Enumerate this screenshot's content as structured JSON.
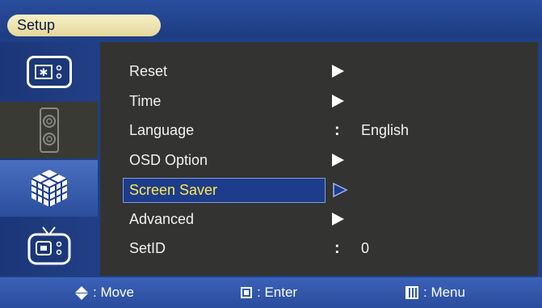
{
  "title": "Setup",
  "sidebar": {
    "items": [
      {
        "icon": "picture-icon"
      },
      {
        "icon": "audio-speaker-icon"
      },
      {
        "icon": "setup-cube-icon"
      },
      {
        "icon": "tv-channel-icon"
      }
    ]
  },
  "menu": {
    "items": [
      {
        "label": "Reset",
        "type": "submenu"
      },
      {
        "label": "Time",
        "type": "submenu"
      },
      {
        "label": "Language",
        "type": "value",
        "value": "English"
      },
      {
        "label": "OSD Option",
        "type": "submenu"
      },
      {
        "label": "Screen Saver",
        "type": "submenu",
        "selected": true
      },
      {
        "label": "Advanced",
        "type": "submenu"
      },
      {
        "label": "SetID",
        "type": "value",
        "value": "0"
      }
    ],
    "colon": ":"
  },
  "help": {
    "move": ": Move",
    "enter": ": Enter",
    "menu": ": Menu"
  },
  "colors": {
    "frame": "#1f3f86",
    "panel": "#333331",
    "selected_text": "#ffe94a",
    "selected_bg": "#1e3c8c"
  }
}
